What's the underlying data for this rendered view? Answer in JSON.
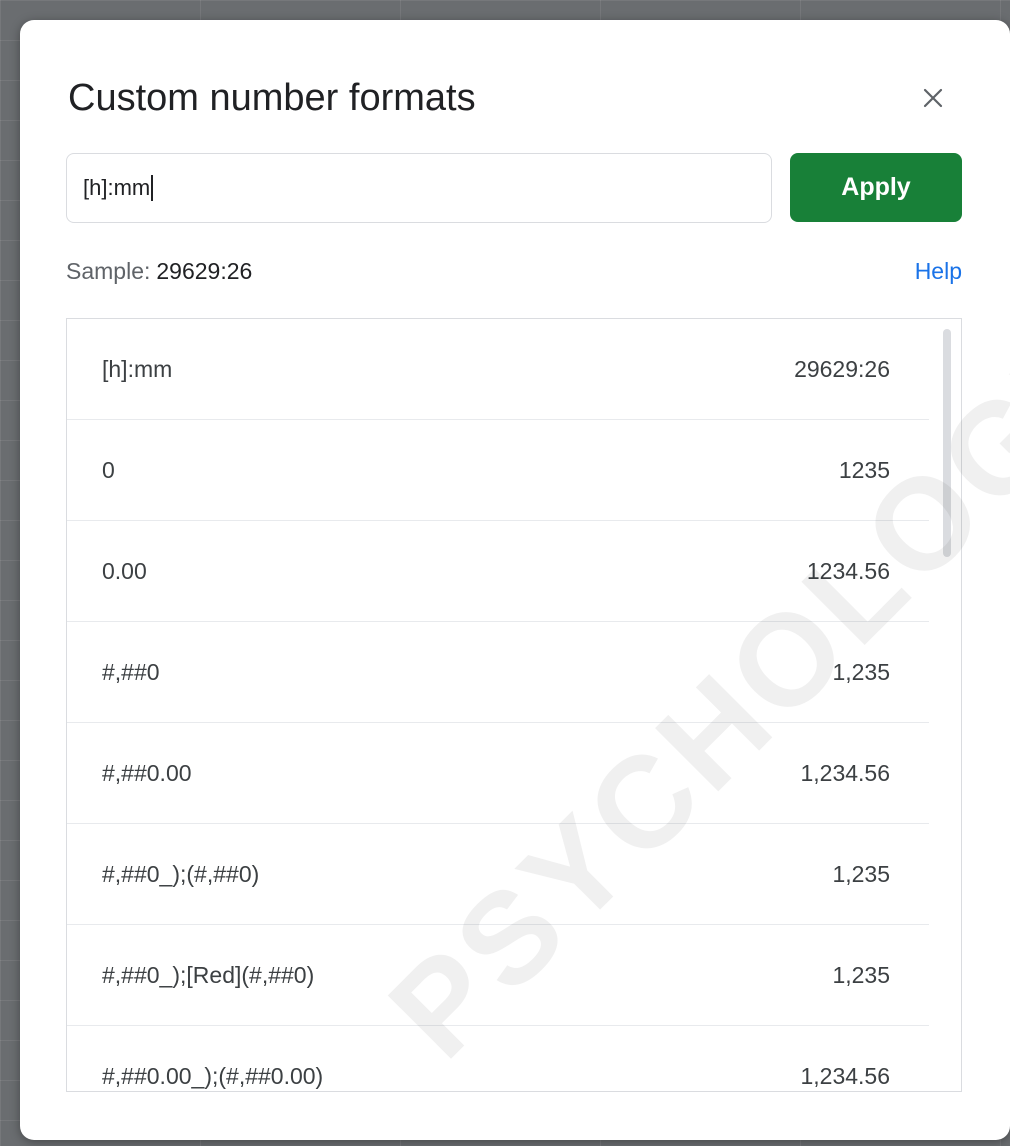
{
  "dialog": {
    "title": "Custom number formats",
    "close_label": "×",
    "input_value": "[h]:mm",
    "apply_label": "Apply",
    "sample_label": "Sample:",
    "sample_value": "29629:26",
    "help_label": "Help"
  },
  "formats": [
    {
      "format": "[h]:mm",
      "sample": "29629:26"
    },
    {
      "format": "0",
      "sample": "1235"
    },
    {
      "format": "0.00",
      "sample": "1234.56"
    },
    {
      "format": "#,##0",
      "sample": "1,235"
    },
    {
      "format": "#,##0.00",
      "sample": "1,234.56"
    },
    {
      "format": "#,##0_);(#,##0)",
      "sample": "1,235"
    },
    {
      "format": "#,##0_);[Red](#,##0)",
      "sample": "1,235"
    },
    {
      "format": "#,##0.00_);(#,##0.00)",
      "sample": "1,234.56"
    }
  ],
  "watermark": "PSYCHOLOGY.C",
  "colors": {
    "apply_bg": "#188038",
    "help_link": "#1a73e8"
  },
  "icons": {
    "close": "close-icon"
  }
}
